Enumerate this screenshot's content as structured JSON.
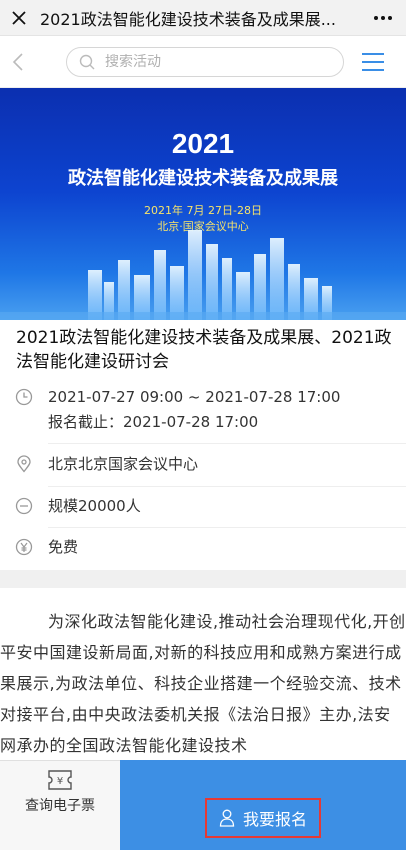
{
  "titlebar": {
    "title": "2021政法智能化建设技术装备及成果展...",
    "more_label": "⋮"
  },
  "search": {
    "placeholder": "搜索活动",
    "value": ""
  },
  "banner": {
    "year": "2021",
    "title": "政法智能化建设技术装备及成果展",
    "date": "2021年 7月 27日-28日",
    "place": "北京·国家会议中心"
  },
  "event": {
    "title": "2021政法智能化建设技术装备及成果展、2021政法智能化建设研讨会",
    "time_range": "2021-07-27 09:00 ~ 2021-07-28 17:00",
    "deadline": "报名截止：2021-07-28 17:00",
    "location": "北京北京国家会议中心",
    "scale": "规模20000人",
    "fee": "免费"
  },
  "description": "为深化政法智能化建设,推动社会治理现代化,开创平安中国建设新局面,对新的科技应用和成熟方案进行成果展示,为政法单位、科技企业搭建一个经验交流、技术对接平台,由中央政法委机关报《法治日报》主办,法安网承办的全国政法智能化建设技术",
  "bottom": {
    "ticket_label": "查询电子票",
    "ticket_icon_text": "¥",
    "signup_label": "我要报名"
  },
  "colors": {
    "accent": "#3d8fe4",
    "highlight": "#e53935"
  }
}
